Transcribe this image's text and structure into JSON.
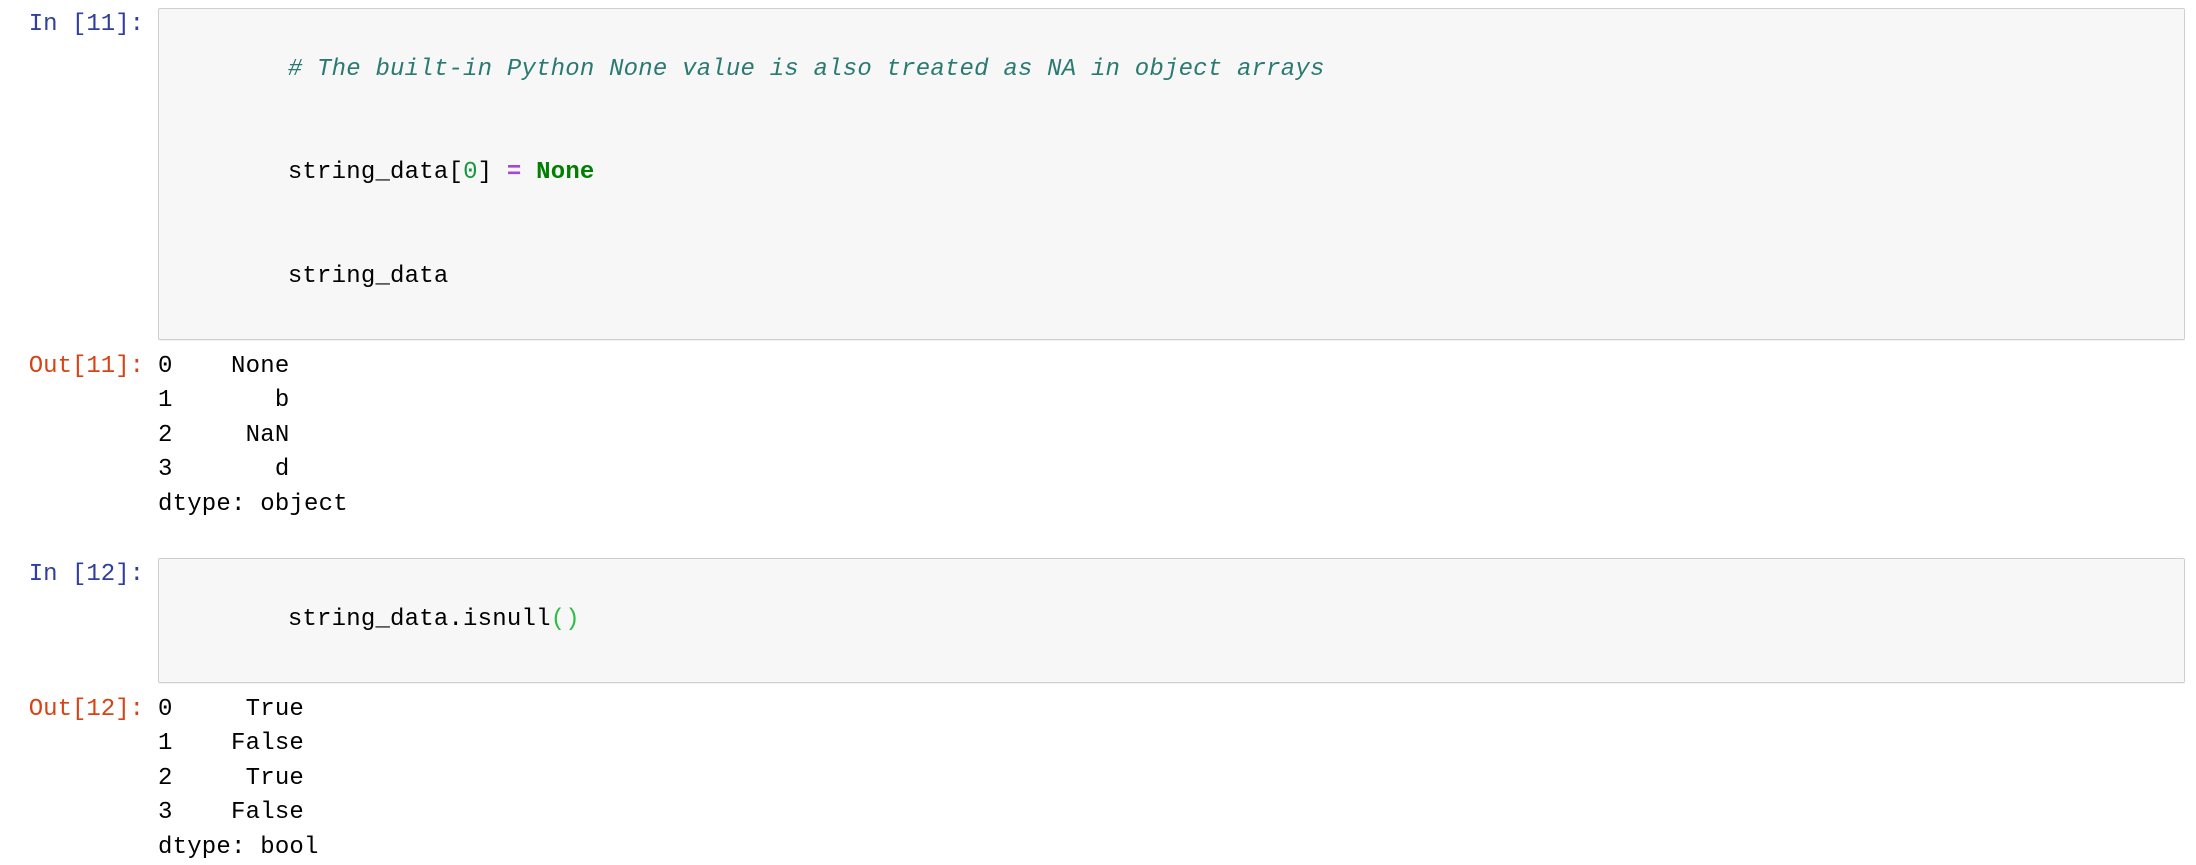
{
  "theme": {
    "page_background": "#ffffff",
    "input_background": "#f7f7f7",
    "input_border": "#cfcfcf",
    "in_prompt_color": "#303f9f",
    "out_prompt_color": "#d84315",
    "comment_color": "#2a7a72",
    "keyword_color": "#008000",
    "operator_color": "#a348d6",
    "number_color": "#1a9641",
    "punctuation_color": "#2dbd48",
    "text_color": "#000000"
  },
  "cells": [
    {
      "type": "code",
      "prompt": "In [11]:",
      "source_lines": [
        {
          "tokens": [
            {
              "text": "# The built-in Python None value is also treated as NA in object arrays",
              "kind": "comment"
            }
          ]
        },
        {
          "tokens": [
            {
              "text": "string_data[",
              "kind": "plain"
            },
            {
              "text": "0",
              "kind": "number"
            },
            {
              "text": "] ",
              "kind": "plain"
            },
            {
              "text": "=",
              "kind": "operator"
            },
            {
              "text": " ",
              "kind": "plain"
            },
            {
              "text": "None",
              "kind": "keyword"
            }
          ]
        },
        {
          "tokens": [
            {
              "text": "string_data",
              "kind": "plain"
            }
          ]
        }
      ],
      "output": {
        "prompt": "Out[11]:",
        "lines": [
          "0    None",
          "1       b",
          "2     NaN",
          "3       d",
          "dtype: object"
        ]
      }
    },
    {
      "type": "code",
      "prompt": "In [12]:",
      "source_lines": [
        {
          "tokens": [
            {
              "text": "string_data.isnull",
              "kind": "plain"
            },
            {
              "text": "()",
              "kind": "punctuation"
            }
          ]
        }
      ],
      "output": {
        "prompt": "Out[12]:",
        "lines": [
          "0     True",
          "1    False",
          "2     True",
          "3    False",
          "dtype: bool"
        ]
      }
    }
  ]
}
